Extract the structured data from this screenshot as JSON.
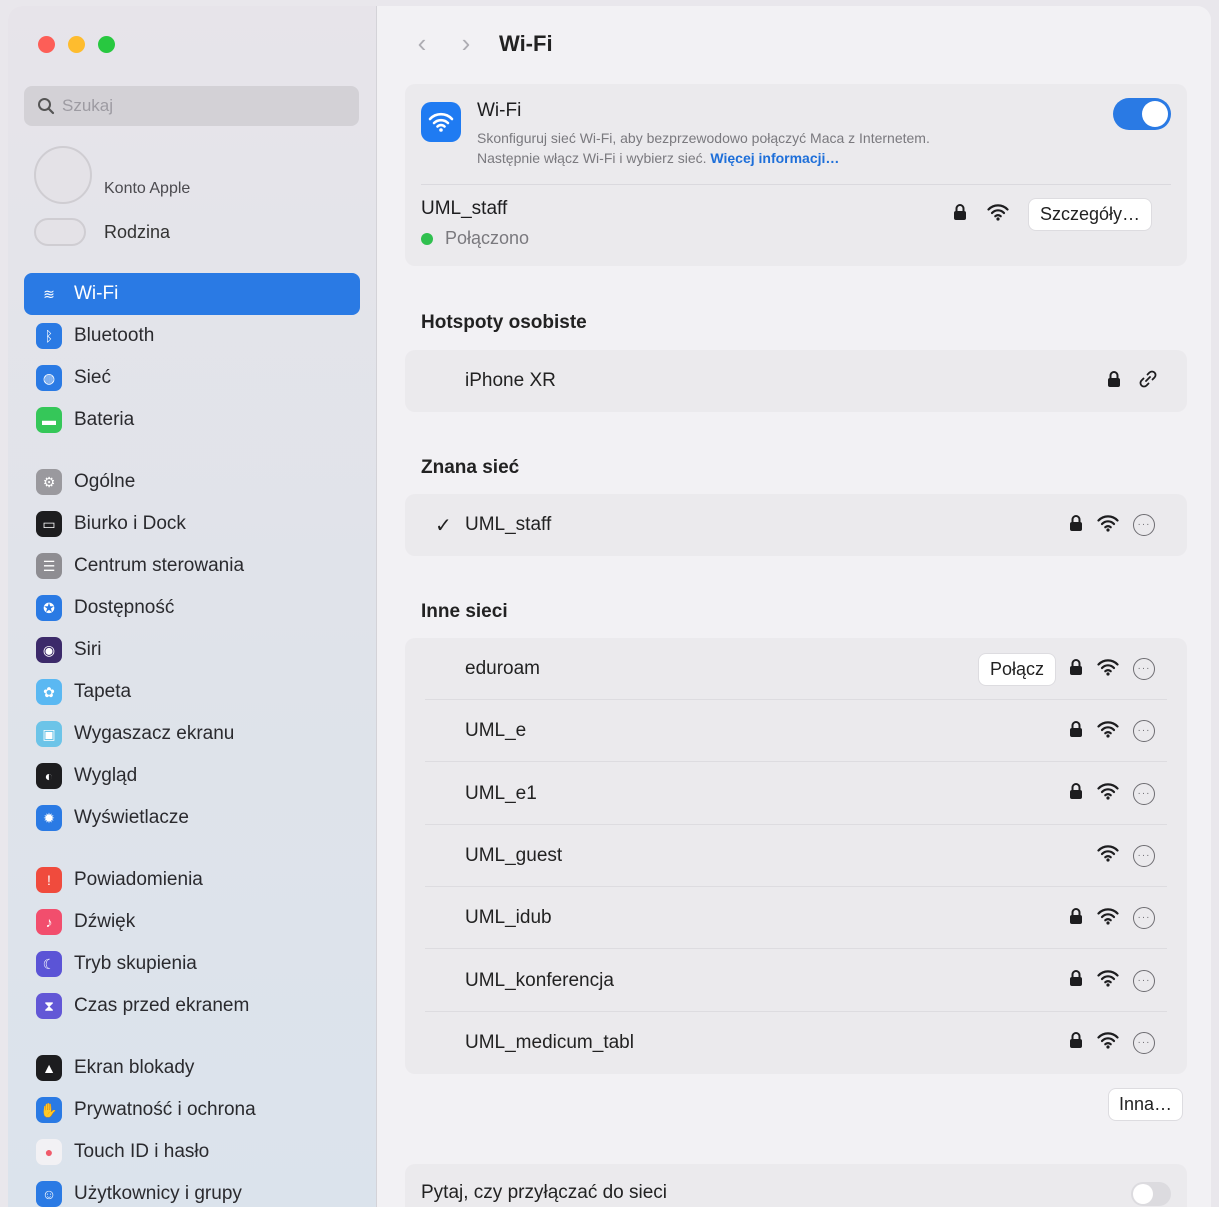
{
  "sidebar": {
    "search_placeholder": "Szukaj",
    "account_label": "Konto Apple",
    "family_label": "Rodzina",
    "items": [
      {
        "label": "Wi-Fi",
        "icon": "wifi-icon",
        "color": "#2a7ae4",
        "active": true
      },
      {
        "label": "Bluetooth",
        "icon": "bluetooth-icon",
        "color": "#2a7ae4"
      },
      {
        "label": "Sieć",
        "icon": "globe-icon",
        "color": "#2a7ae4"
      },
      {
        "label": "Bateria",
        "icon": "battery-icon",
        "color": "#35c759"
      },
      {
        "label": "Ogólne",
        "icon": "gear-icon",
        "color": "#9a999e"
      },
      {
        "label": "Biurko i Dock",
        "icon": "dock-icon",
        "color": "#1d1d1f"
      },
      {
        "label": "Centrum sterowania",
        "icon": "control-center-icon",
        "color": "#8e8d92"
      },
      {
        "label": "Dostępność",
        "icon": "accessibility-icon",
        "color": "#2a7ae4"
      },
      {
        "label": "Siri",
        "icon": "siri-icon",
        "color": "#3c2a6a"
      },
      {
        "label": "Tapeta",
        "icon": "wallpaper-icon",
        "color": "#5ab8f2"
      },
      {
        "label": "Wygaszacz ekranu",
        "icon": "screensaver-icon",
        "color": "#6cc4e8"
      },
      {
        "label": "Wygląd",
        "icon": "appearance-icon",
        "color": "#1d1d1f"
      },
      {
        "label": "Wyświetlacze",
        "icon": "display-icon",
        "color": "#2a7ae4"
      },
      {
        "label": "Powiadomienia",
        "icon": "bell-icon",
        "color": "#f04b3d"
      },
      {
        "label": "Dźwięk",
        "icon": "sound-icon",
        "color": "#f24e6d"
      },
      {
        "label": "Tryb skupienia",
        "icon": "moon-icon",
        "color": "#5b54d6"
      },
      {
        "label": "Czas przed ekranem",
        "icon": "hourglass-icon",
        "color": "#6257d6"
      },
      {
        "label": "Ekran blokady",
        "icon": "lock-screen-icon",
        "color": "#1d1d1f"
      },
      {
        "label": "Prywatność i ochrona",
        "icon": "hand-icon",
        "color": "#2a7ae4"
      },
      {
        "label": "Touch ID i hasło",
        "icon": "fingerprint-icon",
        "color": "#f2f1f4"
      },
      {
        "label": "Użytkownicy i grupy",
        "icon": "users-icon",
        "color": "#2a7ae4"
      }
    ]
  },
  "header": {
    "title": "Wi-Fi"
  },
  "wifi": {
    "title": "Wi-Fi",
    "desc_line1": "Skonfiguruj sieć Wi-Fi, aby bezprzewodowo połączyć Maca z Internetem.",
    "desc_line2": "Następnie włącz Wi-Fi i wybierz sieć.",
    "more_link": "Więcej informacji…",
    "enabled": true,
    "current_network": "UML_staff",
    "current_status": "Połączono",
    "details_button": "Szczegóły…"
  },
  "hotspots": {
    "title": "Hotspoty osobiste",
    "items": [
      {
        "name": "iPhone XR"
      }
    ]
  },
  "known": {
    "title": "Znana sieć",
    "items": [
      {
        "name": "UML_staff",
        "checked": true
      }
    ]
  },
  "others": {
    "title": "Inne sieci",
    "connect_label": "Połącz",
    "items": [
      {
        "name": "eduroam",
        "locked": true
      },
      {
        "name": "UML_e",
        "locked": true
      },
      {
        "name": "UML_e1",
        "locked": true
      },
      {
        "name": "UML_guest",
        "locked": false
      },
      {
        "name": "UML_idub",
        "locked": true
      },
      {
        "name": "UML_konferencja",
        "locked": true
      },
      {
        "name": "UML_medicum_tabl",
        "locked": true
      }
    ]
  },
  "other_button": "Inna…",
  "ask_join": {
    "label": "Pytaj, czy przyłączać do sieci",
    "enabled": false
  }
}
